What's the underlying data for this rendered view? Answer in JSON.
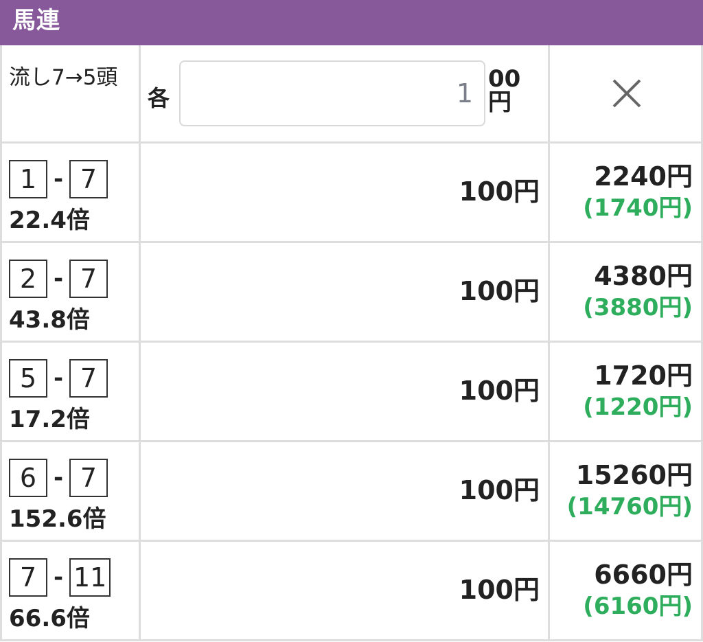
{
  "header": {
    "title": "馬連"
  },
  "summary": {
    "type_label": "流し7→5頭",
    "each_label": "各",
    "amount_value": "1",
    "unit_label": "00円",
    "close_icon": "close-icon"
  },
  "rows": [
    {
      "a": "1",
      "b": "7",
      "odds": "22.4倍",
      "bet": "100円",
      "payout": "2240円",
      "profit": "(1740円)"
    },
    {
      "a": "2",
      "b": "7",
      "odds": "43.8倍",
      "bet": "100円",
      "payout": "4380円",
      "profit": "(3880円)"
    },
    {
      "a": "5",
      "b": "7",
      "odds": "17.2倍",
      "bet": "100円",
      "payout": "1720円",
      "profit": "(1220円)"
    },
    {
      "a": "6",
      "b": "7",
      "odds": "152.6倍",
      "bet": "100円",
      "payout": "15260円",
      "profit": "(14760円)"
    },
    {
      "a": "7",
      "b": "11",
      "odds": "66.6倍",
      "bet": "100円",
      "payout": "6660円",
      "profit": "(6160円)"
    }
  ],
  "colors": {
    "header_bg": "#87599b",
    "profit": "#2eae5d",
    "border": "#dddddd"
  }
}
